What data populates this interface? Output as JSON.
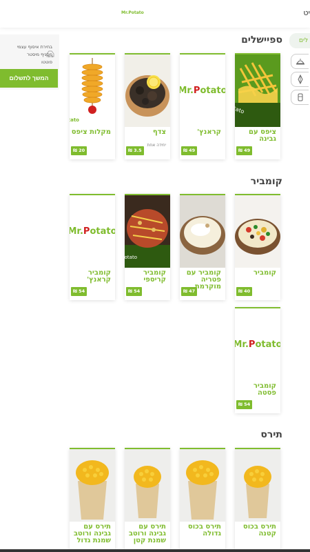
{
  "header": {
    "logo_text": "Mr.Potato",
    "right_text": "יט"
  },
  "side_nav": {
    "active_label": "לים"
  },
  "cart": {
    "line1": "בחירת איסוף עצמי",
    "line2": "מסניף מיסטר",
    "line3": "פוטטו",
    "checkout_label": "המשך לתשלום"
  },
  "sections": [
    {
      "title": "ספיישלים",
      "items": [
        {
          "name": "ציפס עם גבינה",
          "sub": "",
          "price": "49 ₪"
        },
        {
          "name": "קראנץ'",
          "sub": "",
          "price": "49 ₪"
        },
        {
          "name": "צדף",
          "sub": "יחידה אחת",
          "price": "3.5 ₪"
        },
        {
          "name": "מקלות ציפס",
          "sub": "",
          "price": "20 ₪"
        }
      ]
    },
    {
      "title": "קומביר",
      "items": [
        {
          "name": "קומביר",
          "sub": "",
          "price": "40 ₪"
        },
        {
          "name": "קומביר עם פטריה מוקרמת",
          "sub": "",
          "price": "47 ₪"
        },
        {
          "name": "קומביר קריספי",
          "sub": "",
          "price": "54 ₪"
        },
        {
          "name": "קומביר קראנץ'",
          "sub": "",
          "price": "54 ₪"
        },
        {
          "name": "קומביר פסטה",
          "sub": "",
          "price": "54 ₪"
        }
      ]
    },
    {
      "title": "תירס",
      "items": [
        {
          "name": "תירס בכוס קטנה",
          "sub": "",
          "price": ""
        },
        {
          "name": "תירס בכוס גדולה",
          "sub": "",
          "price": ""
        },
        {
          "name": "תירס עם גבינה ורוטב שמנת קטן",
          "sub": "",
          "price": ""
        },
        {
          "name": "תירס עם גבינה ורוטב שמנת גדול",
          "sub": "",
          "price": ""
        }
      ]
    }
  ],
  "colors": {
    "brand_green": "#7fbc2e",
    "brand_red": "#d02020"
  }
}
